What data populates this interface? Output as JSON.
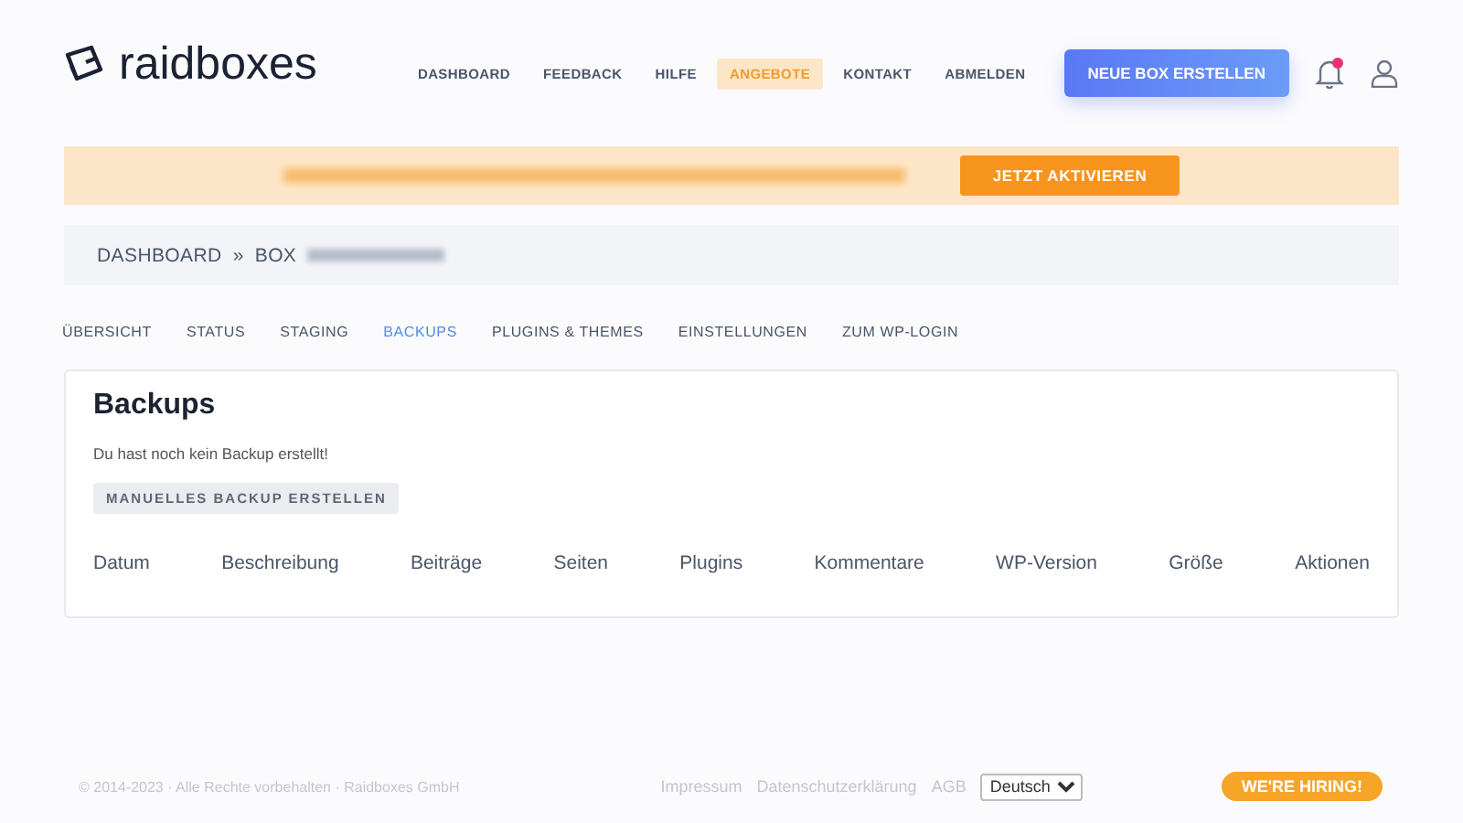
{
  "header": {
    "logo": "raidboxes",
    "nav": [
      {
        "label": "DASHBOARD",
        "highlighted": false
      },
      {
        "label": "FEEDBACK",
        "highlighted": false
      },
      {
        "label": "HILFE",
        "highlighted": false
      },
      {
        "label": "ANGEBOTE",
        "highlighted": true
      },
      {
        "label": "KONTAKT",
        "highlighted": false
      },
      {
        "label": "ABMELDEN",
        "highlighted": false
      }
    ],
    "cta": "NEUE BOX ERSTELLEN",
    "notification_unread": true
  },
  "banner": {
    "button": "JETZT AKTIVIEREN"
  },
  "breadcrumb": {
    "items": [
      "DASHBOARD",
      "BOX"
    ],
    "separator": "»"
  },
  "tabs": [
    {
      "label": "ÜBERSICHT",
      "selected": false
    },
    {
      "label": "STATUS",
      "selected": false
    },
    {
      "label": "STAGING",
      "selected": false
    },
    {
      "label": "BACKUPS",
      "selected": true
    },
    {
      "label": "PLUGINS & THEMES",
      "selected": false
    },
    {
      "label": "EINSTELLUNGEN",
      "selected": false
    },
    {
      "label": "ZUM WP-LOGIN",
      "selected": false
    }
  ],
  "card": {
    "title": "Backups",
    "message": "Du hast noch kein Backup erstellt!",
    "button": "MANUELLES BACKUP ERSTELLEN",
    "columns": [
      "Datum",
      "Beschreibung",
      "Beiträge",
      "Seiten",
      "Plugins",
      "Kommentare",
      "WP-Version",
      "Größe",
      "Aktionen"
    ]
  },
  "footer": {
    "copyright": "© 2014-2023 · Alle Rechte vorbehalten · Raidboxes GmbH",
    "links": [
      "Impressum",
      "Datenschutzerklärung",
      "AGB"
    ],
    "language": "Deutsch",
    "hiring": "WE'RE HIRING!"
  }
}
